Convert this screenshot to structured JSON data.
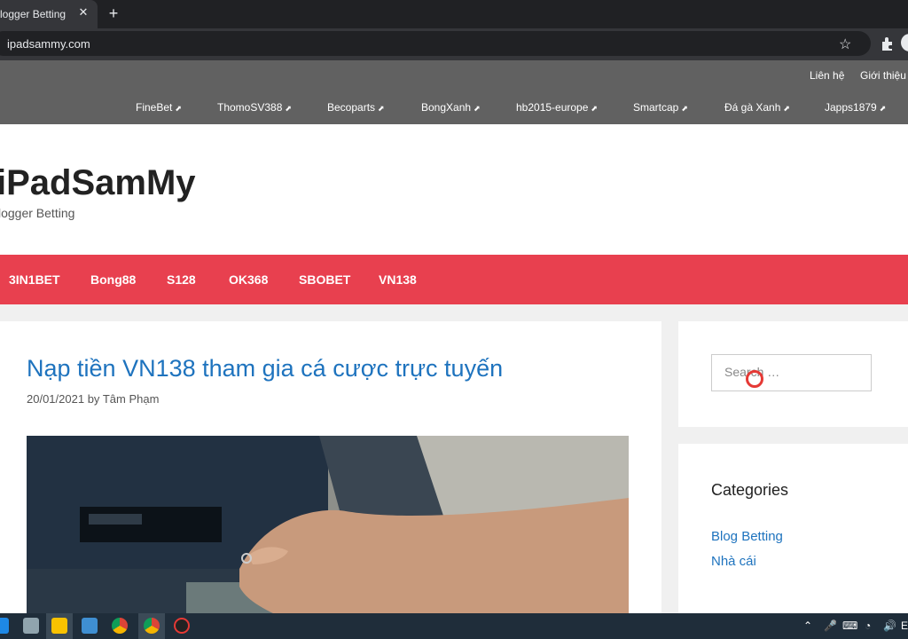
{
  "browser": {
    "tab_title": "logger Betting",
    "url": "ipadsammy.com"
  },
  "topnav": {
    "secondary": [
      "Liên hệ",
      "Giới thiệu"
    ],
    "links": [
      "FineBet",
      "ThomoSV388",
      "Becoparts",
      "BongXanh",
      "hb2015-europe",
      "Smartcap",
      "Đá gà Xanh",
      "Japps1879"
    ]
  },
  "header": {
    "title": "iPadSamMy",
    "description": "logger Betting"
  },
  "mainnav": {
    "items": [
      "3IN1BET",
      "Bong88",
      "S128",
      "OK368",
      "SBOBET",
      "VN138"
    ]
  },
  "article": {
    "title": "Nạp tiền VN138 tham gia cá cược trực tuyến",
    "date": "20/01/2021",
    "by": "by",
    "author": "Tâm Phạm"
  },
  "sidebar": {
    "search_placeholder": "Search …",
    "categories_title": "Categories",
    "categories": [
      "Blog Betting",
      "Nhà cái"
    ]
  },
  "colors": {
    "brand_red": "#e8404f",
    "link_blue": "#1e73be"
  }
}
